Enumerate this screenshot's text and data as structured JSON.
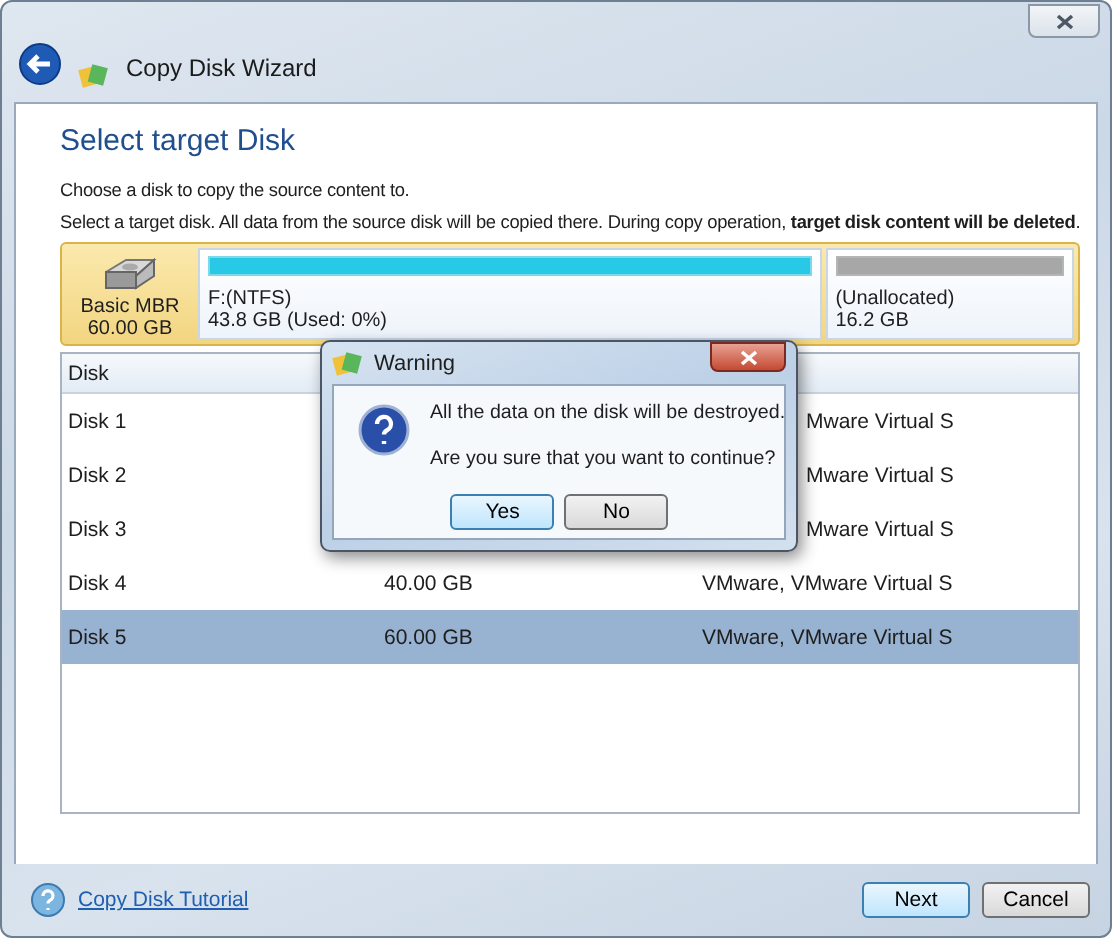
{
  "window": {
    "title": "Copy Disk Wizard"
  },
  "heading": "Select target Disk",
  "intro": "Choose a disk to copy the source content to.",
  "notice": "Select a target disk. All data from the source disk will be copied there. During copy operation, **target disk content will be deleted**.",
  "disk_map": {
    "label": "Basic MBR",
    "size": "60.00 GB",
    "partitions": [
      {
        "kind": "used",
        "name": "F:(NTFS)",
        "detail": "43.8 GB (Used: 0%)"
      },
      {
        "kind": "unallocated",
        "name": "(Unallocated)",
        "detail": "16.2 GB"
      }
    ]
  },
  "table": {
    "columns": [
      "Disk"
    ],
    "rows": [
      {
        "disk": "Disk 1",
        "model": "Mware Virtual S",
        "selected": false
      },
      {
        "disk": "Disk 2",
        "model": "Mware Virtual S",
        "selected": false
      },
      {
        "disk": "Disk 3",
        "model": "Mware Virtual S",
        "selected": false
      },
      {
        "disk": "Disk 4",
        "size": "40.00 GB",
        "model": "VMware, VMware Virtual S",
        "selected": false
      },
      {
        "disk": "Disk 5",
        "size": "60.00 GB",
        "model": "VMware, VMware Virtual S",
        "selected": true
      }
    ]
  },
  "dialog": {
    "title": "Warning",
    "message": "All the data on the disk will be destroyed.",
    "question": "Are you sure that you want to continue?",
    "buttons": [
      {
        "label": "Yes",
        "default": true
      },
      {
        "label": "No",
        "default": false
      }
    ]
  },
  "footer": {
    "link": "Copy Disk Tutorial",
    "buttons": [
      {
        "label": "Next",
        "default": true
      },
      {
        "label": "Cancel",
        "default": false
      }
    ]
  }
}
